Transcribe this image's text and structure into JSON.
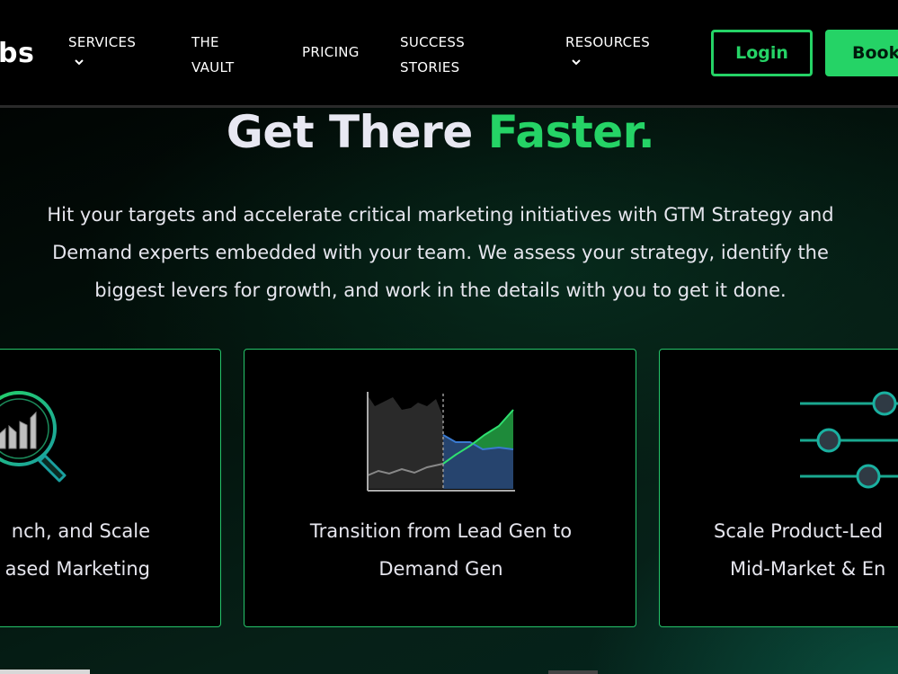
{
  "nav": {
    "logo": "bs",
    "items": [
      {
        "line1": "SERVICES",
        "line2": "",
        "has_chevron": true
      },
      {
        "line1": "THE",
        "line2": "VAULT",
        "has_chevron": false
      },
      {
        "line1": "PRICING",
        "line2": "",
        "has_chevron": false
      },
      {
        "line1": "SUCCESS",
        "line2": "STORIES",
        "has_chevron": false
      },
      {
        "line1": "RESOURCES",
        "line2": "",
        "has_chevron": true
      }
    ],
    "login_label": "Login",
    "book_label": "Book"
  },
  "hero": {
    "headline_white": "Get There ",
    "headline_green": "Faster.",
    "subtext_lines": [
      "Hit your targets and accelerate critical marketing initiatives with GTM Strategy and",
      "Demand experts embedded with your team.  We assess your strategy, identify the",
      "biggest levers for growth, and work in the details with you to get it done."
    ]
  },
  "cards": [
    {
      "icon": "magnifier-chart-icon",
      "lines": [
        "nch, and Scale",
        "ased Marketing"
      ]
    },
    {
      "icon": "area-chart-icon",
      "lines": [
        "Transition from Lead Gen to",
        "Demand Gen"
      ]
    },
    {
      "icon": "sliders-icon",
      "lines": [
        "Scale Product-Led",
        "Mid-Market & En"
      ]
    }
  ],
  "colors": {
    "accent": "#25d366",
    "background": "#000000"
  }
}
